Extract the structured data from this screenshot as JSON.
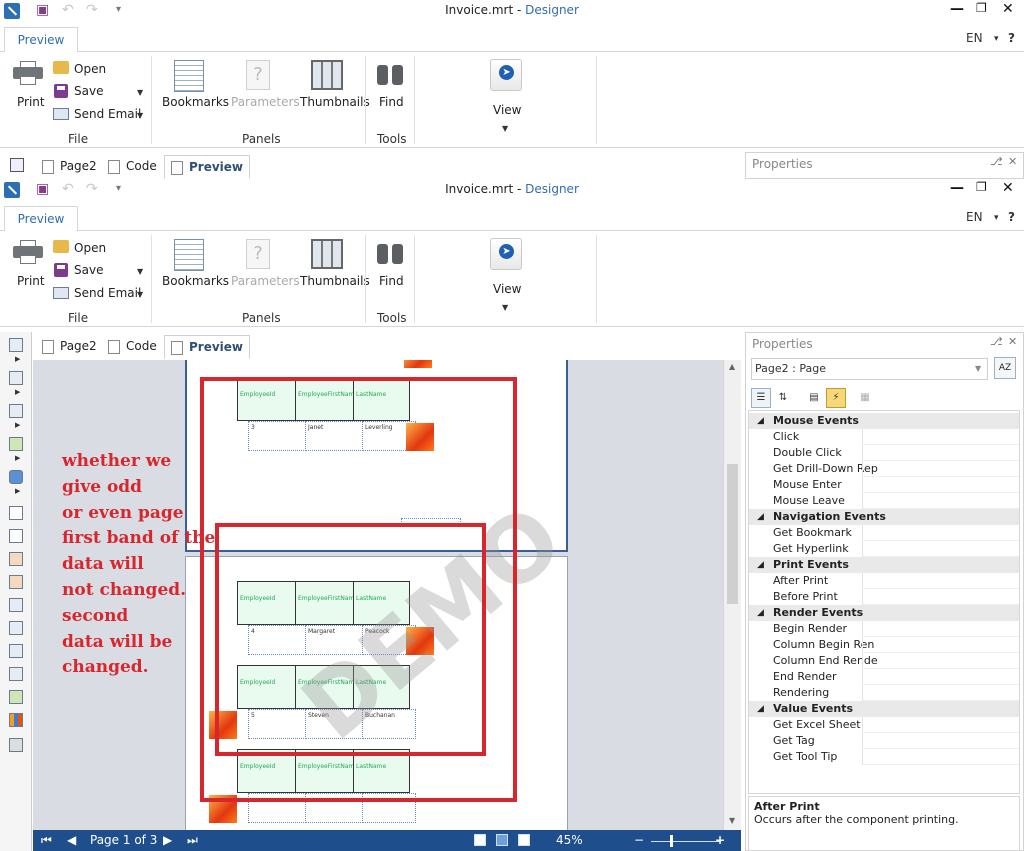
{
  "windows": [
    {
      "title": "Invoice.mrt",
      "designer": "Designer",
      "tab": "Preview",
      "lang": "EN",
      "ribbon": {
        "print": "Print",
        "open": "Open",
        "save": "Save",
        "send_email": "Send Email",
        "group_file": "File",
        "bookmarks": "Bookmarks",
        "parameters": "Parameters",
        "thumbnails": "Thumbnails",
        "group_panels": "Panels",
        "find": "Find",
        "group_tools": "Tools",
        "view": "View"
      },
      "doctabs": [
        "Page2",
        "Code",
        "Preview"
      ],
      "properties_title": "Properties"
    },
    {
      "title": "Invoice.mrt",
      "designer": "Designer",
      "tab": "Preview",
      "lang": "EN",
      "ribbon": {
        "print": "Print",
        "open": "Open",
        "save": "Save",
        "send_email": "Send Email",
        "group_file": "File",
        "bookmarks": "Bookmarks",
        "parameters": "Parameters",
        "thumbnails": "Thumbnails",
        "group_panels": "Panels",
        "find": "Find",
        "group_tools": "Tools",
        "view": "View"
      },
      "doctabs": [
        "Page2",
        "Code",
        "Preview"
      ],
      "properties_title": "Properties"
    }
  ],
  "properties": {
    "selected": "Page2 : Page",
    "categories": [
      {
        "name": "Mouse  Events",
        "items": [
          "Click",
          "Double Click",
          "Get Drill-Down Rep",
          "Mouse Enter",
          "Mouse Leave"
        ]
      },
      {
        "name": "Navigation  Events",
        "items": [
          "Get Bookmark",
          "Get Hyperlink"
        ]
      },
      {
        "name": "Print  Events",
        "items": [
          "After Print",
          "Before Print"
        ]
      },
      {
        "name": "Render  Events",
        "items": [
          "Begin Render",
          "Column Begin Ren",
          "Column End Rende",
          "End Render",
          "Rendering"
        ]
      },
      {
        "name": "Value  Events",
        "items": [
          "Get Excel Sheet",
          "Get Tag",
          "Get Tool Tip"
        ]
      }
    ],
    "description_title": "After Print",
    "description_text": "Occurs after the component printing."
  },
  "report": {
    "header_cells": [
      "EmployeeId",
      "EmployeeFirstName",
      "LastName"
    ],
    "records": [
      [
        "3",
        "Janet",
        "Leverling"
      ],
      [
        "4",
        "Margaret",
        "Peacock"
      ],
      [
        "5",
        "Steven",
        "Buchanan"
      ],
      [
        "",
        "",
        ""
      ]
    ],
    "watermark": "DEMO"
  },
  "annotation": [
    "whether we",
    "give odd",
    "or even page",
    "first band of the",
    "data will",
    "not changed.",
    "second",
    "data will be",
    "changed."
  ],
  "status": {
    "page": "Page 1 of 3",
    "zoom": "45%",
    "minus": "−",
    "plus": "+"
  }
}
